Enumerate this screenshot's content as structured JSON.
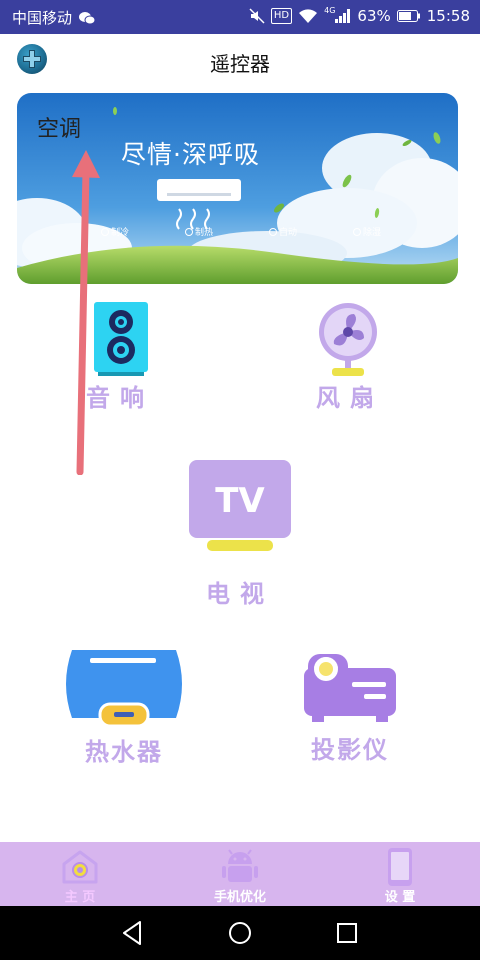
{
  "status_bar": {
    "carrier": "中国移动",
    "network": "4G",
    "battery": "63%",
    "time": "15:58",
    "icons": [
      "wechat-icon",
      "mute-icon",
      "hd-icon",
      "wifi-icon",
      "signal-icon",
      "battery-icon"
    ],
    "hd_label": "HD"
  },
  "header": {
    "title": "遥控器",
    "plus_icon": "plus-circle-icon"
  },
  "banner": {
    "label": "空调",
    "slogan": "尽情·深呼吸",
    "modes": [
      "制冷",
      "制热",
      "自动",
      "除湿"
    ]
  },
  "devices": {
    "speaker": {
      "label": "音响",
      "icon": "speaker-icon"
    },
    "fan": {
      "label": "风扇",
      "icon": "fan-icon"
    },
    "tv": {
      "label": "电视",
      "icon": "tv-icon",
      "icon_text": "TV"
    },
    "heater": {
      "label": "热水器",
      "icon": "water-heater-icon"
    },
    "projector": {
      "label": "投影仪",
      "icon": "projector-icon"
    }
  },
  "bottom_nav": {
    "items": [
      {
        "label": "主 页",
        "icon": "home-icon",
        "active": true
      },
      {
        "label": "手机优化",
        "icon": "android-icon",
        "active": false
      },
      {
        "label": "设 置",
        "icon": "phone-icon",
        "active": false
      }
    ]
  },
  "colors": {
    "status_bar": "#3a3f9e",
    "device_label": "#c2a8ea",
    "bottom_nav": "#d7b5ee",
    "speaker": "#2dd3f2",
    "heater_blue": "#3f93ee",
    "heater_yellow": "#f4c23b",
    "tv_purple": "#c2a8ea",
    "tv_stand": "#ece24a",
    "arrow": "#e8707a"
  }
}
